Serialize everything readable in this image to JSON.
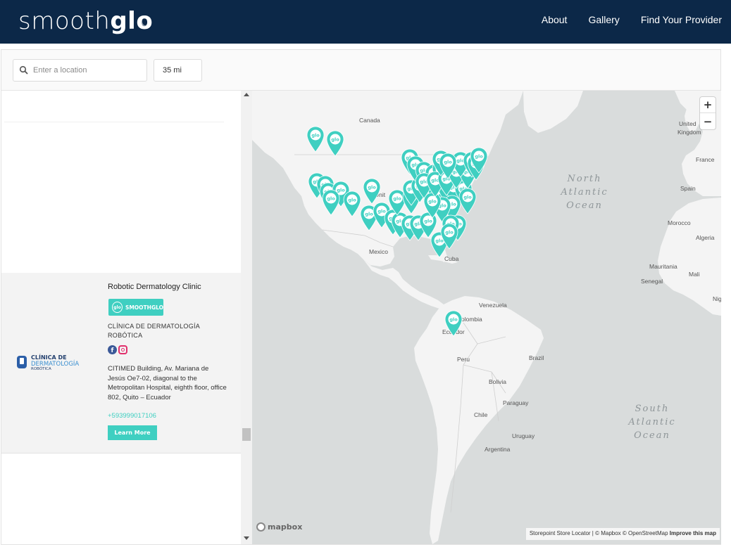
{
  "header": {
    "logo_light": "smooth",
    "logo_bold": "glo",
    "nav": [
      "About",
      "Gallery",
      "Find Your Provider"
    ]
  },
  "search": {
    "placeholder": "Enter a location",
    "radius": "35 mi"
  },
  "listing": {
    "name": "Robotic Dermatology Clinic",
    "badge_icon": "glo",
    "badge_text": "SMOOTHGLO",
    "subtitle": "CLÍNICA DE DERMATOLOGÍA ROBÓTICA",
    "logo_line1": "CLÍNICA DE",
    "logo_line2": "DERMATOLOGÍA",
    "logo_line3": "ROBÓTICA",
    "address": "CITIMED Building, Av. Mariana de Jesús Oe7-02, diagonal to the Metropolitan Hospital, eighth floor, office 802, Quito – Ecuador",
    "phone": "+593999017106",
    "cta": "Learn More"
  },
  "map": {
    "marker_text": "glo",
    "marker_color": "#3fcfc1",
    "land_color": "#f4f4f4",
    "water_color": "#d9dcdc",
    "labels": {
      "canada": "Canada",
      "mexico": "Mexico",
      "cuba": "Cuba",
      "venezuela": "Venezuela",
      "colombia": "olombia",
      "ecuador": "Ecuador",
      "peru": "Peru",
      "brazil": "Brazil",
      "bolivia": "Bolivia",
      "paraguay": "Paraguay",
      "chile": "Chile",
      "uruguay": "Uruguay",
      "argentina": "Argentina",
      "united_kingdom_1": "United",
      "united_kingdom_2": "Kingdom",
      "france": "France",
      "spain": "Spain",
      "morocco": "Morocco",
      "algeria": "Algeria",
      "mauritania": "Mauritania",
      "mali": "Mali",
      "senegal": "Senegal",
      "nig": "Nig",
      "unit": "Unit"
    },
    "oceans": {
      "north_atlantic": [
        "North",
        "Atlantic",
        "Ocean"
      ],
      "south_atlantic": [
        "South",
        "Atlantic",
        "Ocean"
      ]
    },
    "zoom_in": "+",
    "zoom_out": "−",
    "mapbox": "mapbox",
    "attribution": {
      "locator": "Storepoint Store Locator",
      "mapbox": "| © Mapbox",
      "osm": "© OpenStreetMap",
      "improve": "Improve this map"
    }
  }
}
